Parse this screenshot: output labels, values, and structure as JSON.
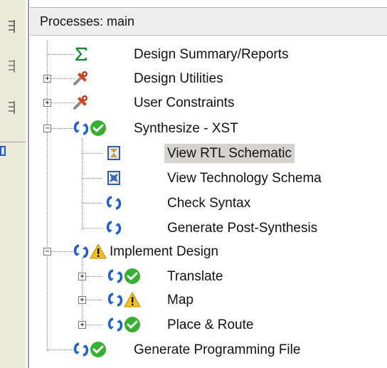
{
  "panel": {
    "title": "Processes: main"
  },
  "tree": {
    "items": [
      {
        "label": "Design Summary/Reports",
        "icon": "sigma-icon"
      },
      {
        "label": "Design Utilities",
        "icon": "tools-icon"
      },
      {
        "label": "User Constraints",
        "icon": "tools-icon"
      },
      {
        "label": "Synthesize - XST",
        "icon": "refresh-success-icon"
      },
      {
        "label": "View RTL Schematic",
        "icon": "rtl-schematic-icon",
        "selected": true
      },
      {
        "label": "View Technology Schema",
        "icon": "tech-schematic-icon"
      },
      {
        "label": "Check Syntax",
        "icon": "refresh-icon"
      },
      {
        "label": "Generate Post-Synthesis",
        "icon": "refresh-icon"
      },
      {
        "label": "Implement Design",
        "icon": "refresh-warning-icon"
      },
      {
        "label": "Translate",
        "icon": "refresh-success-icon"
      },
      {
        "label": "Map",
        "icon": "refresh-warning-icon"
      },
      {
        "label": "Place & Route",
        "icon": "refresh-success-icon"
      },
      {
        "label": "Generate Programming File",
        "icon": "refresh-success-icon"
      }
    ]
  },
  "colors": {
    "refresh_blue": "#1f5fd1",
    "success_green": "#35b12f",
    "warning_yellow": "#f4c20d",
    "selection_gray": "#d6d3ce"
  }
}
